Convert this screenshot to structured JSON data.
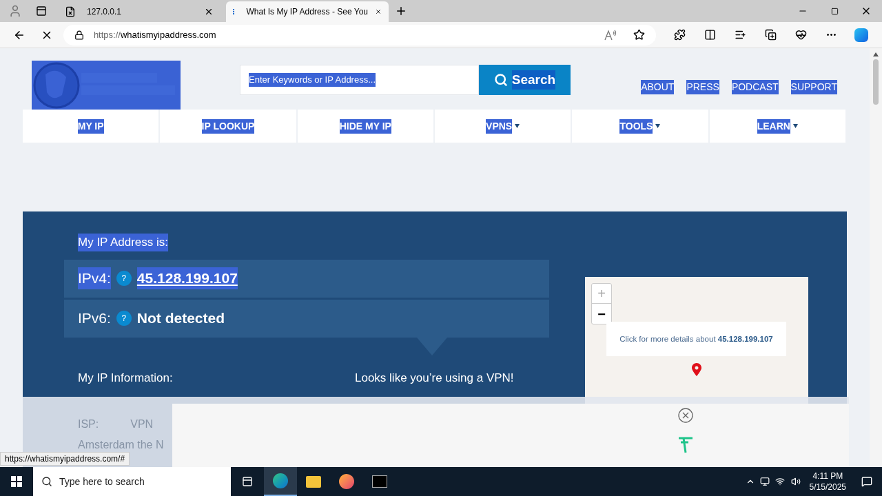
{
  "browser": {
    "tabs": [
      {
        "title": "127.0.0.1",
        "selected": false
      },
      {
        "title": "What Is My IP Address - See You",
        "selected": true
      }
    ],
    "url_scheme": "https://",
    "url_host": "whatismyipaddress.com",
    "status_link": "https://whatismyipaddress.com/#"
  },
  "site": {
    "search_placeholder": "Enter Keywords or IP Address...",
    "search_button": "Search",
    "top_links": [
      "ABOUT",
      "PRESS",
      "PODCAST",
      "SUPPORT"
    ],
    "nav": [
      {
        "label": "MY IP",
        "dropdown": false
      },
      {
        "label": "IP LOOKUP",
        "dropdown": false
      },
      {
        "label": "HIDE MY IP",
        "dropdown": false
      },
      {
        "label": "VPNS",
        "dropdown": true
      },
      {
        "label": "TOOLS",
        "dropdown": true
      },
      {
        "label": "LEARN",
        "dropdown": true
      }
    ],
    "ip_heading": "My IP Address is:",
    "ip_rows": [
      {
        "label": "IPv4:",
        "help": "?",
        "value": "45.128.199.107",
        "link": true
      },
      {
        "label": "IPv6:",
        "help": "?",
        "value": "Not detected",
        "link": false
      }
    ],
    "info_heading": "My IP Information:",
    "vpn_notice": "Looks like you’re using a VPN!",
    "info_faded": [
      [
        "ISP:",
        "VPN"
      ],
      [
        "Amsterdam the N"
      ]
    ],
    "map": {
      "zoom_in": "+",
      "zoom_out": "−",
      "popup_text": "Click for more details about ",
      "popup_ip": "45.128.199.107"
    }
  },
  "taskbar": {
    "search_placeholder": "Type here to search",
    "time": "4:11 PM",
    "date": "5/15/2025"
  }
}
